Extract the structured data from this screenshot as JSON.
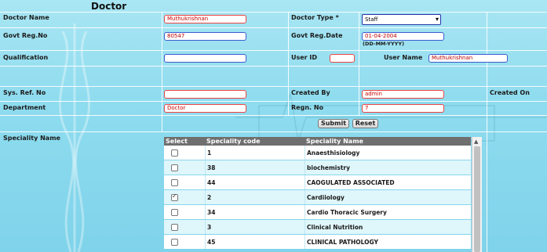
{
  "page": {
    "title": "Doctor"
  },
  "form": {
    "doctor_name_label": "Doctor Name",
    "doctor_name_value": "Muthukrishnan",
    "doctor_type_label": "Doctor Type *",
    "doctor_type_value": "Staff",
    "govt_reg_no_label": "Govt Reg.No",
    "govt_reg_no_value": "80547",
    "govt_reg_date_label": "Govt Reg.Date",
    "govt_reg_date_value": "01-04-2004",
    "date_format_hint": "(DD-MM-YYYY)",
    "qualification_label": "Qualification",
    "qualification_value": "",
    "user_id_label": "User ID",
    "user_id_value": "",
    "user_name_label": "User Name",
    "user_name_value": "Muthukrishnan",
    "sys_ref_no_label": "Sys. Ref. No",
    "sys_ref_no_value": "",
    "created_by_label": "Created By",
    "created_by_value": "admin",
    "created_on_label": "Created On",
    "department_label": "Department",
    "department_value": "Doctor",
    "regn_no_label": "Regn. No",
    "regn_no_value": "7",
    "submit_label": "Submit",
    "reset_label": "Reset",
    "speciality_name_label": "Speciality Name"
  },
  "speciality_table": {
    "headers": [
      "Select",
      "Speciality code",
      "Speciality Name"
    ],
    "rows": [
      {
        "checked": false,
        "code": "1",
        "name": "Anaesthisiology"
      },
      {
        "checked": false,
        "code": "38",
        "name": "biochemistry"
      },
      {
        "checked": false,
        "code": "44",
        "name": "CAOGULATED ASSOCIATED"
      },
      {
        "checked": true,
        "code": "2",
        "name": "Cardiiology"
      },
      {
        "checked": false,
        "code": "34",
        "name": "Cardio Thoracic Surgery"
      },
      {
        "checked": false,
        "code": "3",
        "name": "Clinical Nutrition"
      },
      {
        "checked": false,
        "code": "45",
        "name": "CLINICAL PATHOLOGY"
      }
    ]
  },
  "colors": {
    "background": "#8fdcef",
    "required_border": "#e44444",
    "input_border": "#3b5bd0",
    "table_header": "#6f6f6f"
  }
}
